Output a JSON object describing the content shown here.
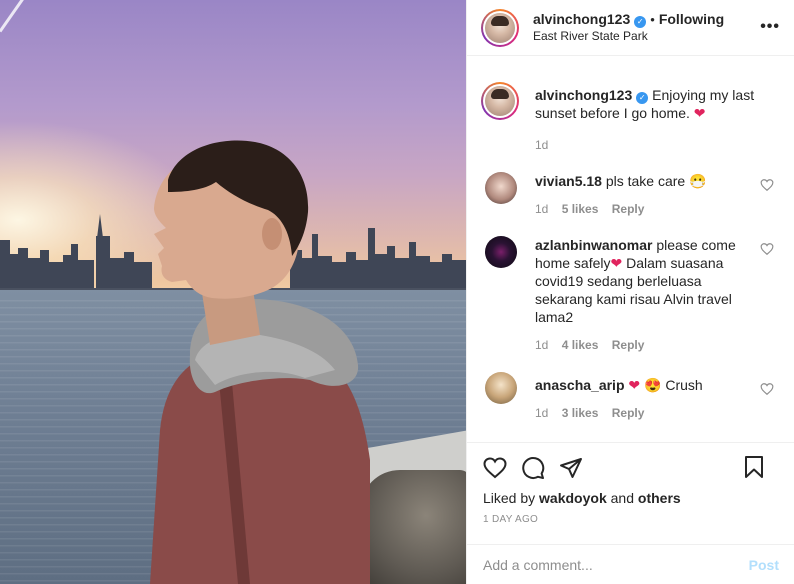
{
  "header": {
    "username": "alvinchong123",
    "dot": "•",
    "following": "Following",
    "location": "East River State Park",
    "more": "•••"
  },
  "caption": {
    "username": "alvinchong123",
    "text": "Enjoying my last sunset before I go home.",
    "emoji": "❤",
    "time": "1d"
  },
  "comments": [
    {
      "username": "vivian5.18",
      "text": "pls take care",
      "emoji": "😷",
      "time": "1d",
      "likes": "5 likes",
      "reply": "Reply",
      "avatar_color": "#a98f86"
    },
    {
      "username": "azlanbinwanomar",
      "text_a": "please come home safely",
      "emoji": "❤",
      "text_b": "Dalam suasana covid19 sedang berleluasa sekarang kami risau Alvin travel lama2",
      "time": "1d",
      "likes": "4 likes",
      "reply": "Reply",
      "avatar_color": "#1b1326"
    },
    {
      "username": "anascha_arip",
      "emoji_a": "❤",
      "emoji_b": "😍",
      "text": "Crush",
      "time": "1d",
      "likes": "3 likes",
      "reply": "Reply",
      "avatar_color": "#c7a97c"
    }
  ],
  "actions": {
    "liked_prefix": "Liked by",
    "liked_user": "wakdoyok",
    "liked_and": "and",
    "liked_others": "others",
    "date": "1 DAY AGO"
  },
  "comment_box": {
    "placeholder": "Add a comment...",
    "post": "Post"
  },
  "colors": {
    "verified": "#3897f0",
    "heart": "#e0245e",
    "post_disabled": "#b2dffc",
    "muted": "#8e8e8e"
  }
}
